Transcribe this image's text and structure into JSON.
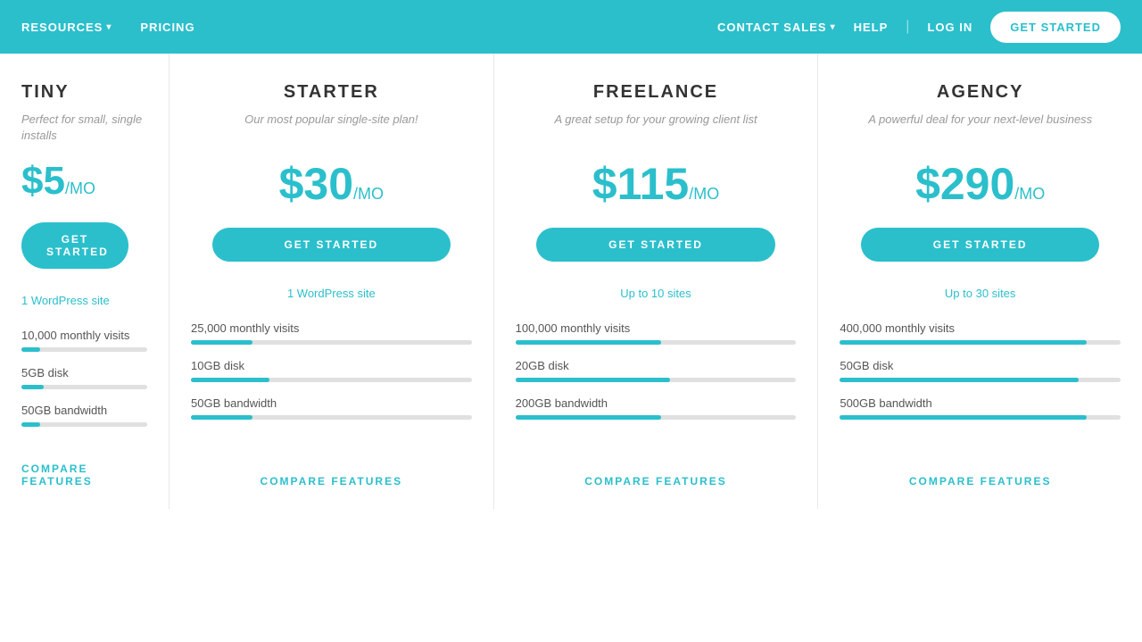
{
  "nav": {
    "left_items": [
      {
        "label": "RESOURCES",
        "has_chevron": true
      },
      {
        "label": "PRICING",
        "has_chevron": false
      }
    ],
    "right_items": [
      {
        "label": "CONTACT SALES",
        "has_chevron": true
      },
      {
        "label": "HELP"
      },
      {
        "label": "|",
        "is_divider": true
      },
      {
        "label": "LOG IN"
      }
    ],
    "cta_label": "GET STARTED"
  },
  "plans": [
    {
      "id": "tiny",
      "name": "TINY",
      "tagline": "Perfect for small, single installs",
      "price": "$5",
      "mo": "/MO",
      "cta": "GET STARTED",
      "sites": "1 WordPress site",
      "stats": [
        {
          "label": "10,000 monthly visits",
          "fill_pct": 15
        },
        {
          "label": "5GB disk",
          "fill_pct": 18
        },
        {
          "label": "50GB bandwidth",
          "fill_pct": 15
        }
      ],
      "compare": "COMPARE FEATURES"
    },
    {
      "id": "starter",
      "name": "STARTER",
      "tagline": "Our most popular single-site plan!",
      "price": "$30",
      "mo": "/MO",
      "cta": "GET STARTED",
      "sites": "1 WordPress site",
      "stats": [
        {
          "label": "25,000 monthly visits",
          "fill_pct": 22
        },
        {
          "label": "10GB disk",
          "fill_pct": 28
        },
        {
          "label": "50GB bandwidth",
          "fill_pct": 22
        }
      ],
      "compare": "COMPARE FEATURES"
    },
    {
      "id": "freelance",
      "name": "FREELANCE",
      "tagline": "A great setup for your growing client list",
      "price": "$115",
      "mo": "/MO",
      "cta": "GET STARTED",
      "sites": "Up to 10 sites",
      "stats": [
        {
          "label": "100,000 monthly visits",
          "fill_pct": 52
        },
        {
          "label": "20GB disk",
          "fill_pct": 55
        },
        {
          "label": "200GB bandwidth",
          "fill_pct": 52
        }
      ],
      "compare": "COMPARE FEATURES"
    },
    {
      "id": "agency",
      "name": "AGENCY",
      "tagline": "A powerful deal for your next-level business",
      "price": "$290",
      "mo": "/MO",
      "cta": "GET STARTED",
      "sites": "Up to 30 sites",
      "stats": [
        {
          "label": "400,000 monthly visits",
          "fill_pct": 88
        },
        {
          "label": "50GB disk",
          "fill_pct": 85
        },
        {
          "label": "500GB bandwidth",
          "fill_pct": 88
        }
      ],
      "compare": "COMPARE FEATURES"
    }
  ]
}
